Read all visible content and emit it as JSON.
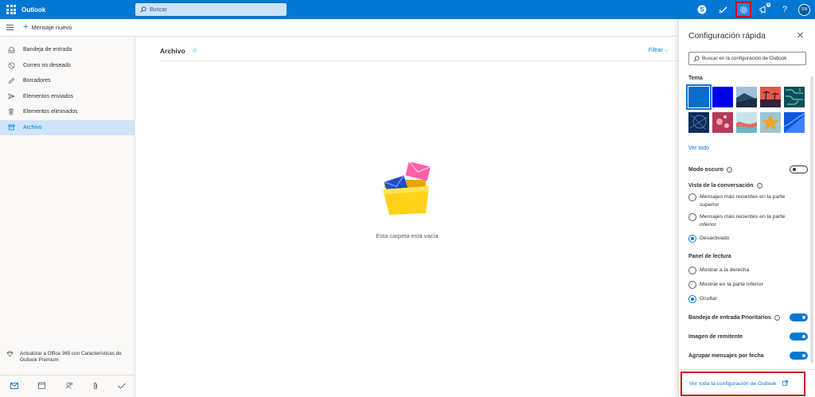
{
  "topbar": {
    "brand": "Outlook",
    "search_placeholder": "Buscar",
    "notification_count": "5",
    "avatar_initials": "SN",
    "help_glyph": "?",
    "bg_color": "#0078d4"
  },
  "cmdbar": {
    "new_message_label": "Mensaje nuevo"
  },
  "nav": {
    "items": [
      {
        "label": "Bandeja de entrada",
        "icon": "inbox-icon"
      },
      {
        "label": "Correo no deseado",
        "icon": "junk-icon"
      },
      {
        "label": "Borradores",
        "icon": "pencil-icon"
      },
      {
        "label": "Elementos enviados",
        "icon": "send-icon"
      },
      {
        "label": "Elementos eliminados",
        "icon": "trash-icon"
      },
      {
        "label": "Archivo",
        "icon": "archive-icon",
        "active": true
      }
    ],
    "upsell_text": "Actualizar a Office 365 con Características de Outlook Premium"
  },
  "main": {
    "folder_title": "Archivo",
    "filter_label": "Filtrar",
    "empty_text": "Esta carpeta está vacía"
  },
  "settings": {
    "title": "Configuración rápida",
    "search_placeholder": "Buscar en la configuración de Outlook",
    "theme_label": "Tema",
    "see_all": "Ver todo",
    "dark_mode": "Modo oscuro",
    "conversation_label": "Vista de la conversación",
    "conversation_options": [
      {
        "label": "Mensajes más recientes en la parte superior",
        "checked": false
      },
      {
        "label": "Mensajes más recientes en la parte inferior",
        "checked": false
      },
      {
        "label": "Desactivado",
        "checked": true
      }
    ],
    "reading_label": "Panel de lectura",
    "reading_options": [
      {
        "label": "Mostrar a la derecha",
        "checked": false
      },
      {
        "label": "Mostrar en la parte inferior",
        "checked": false
      },
      {
        "label": "Ocultar",
        "checked": true
      }
    ],
    "focused_inbox": "Bandeja de entrada Prioritarios",
    "sender_image": "Imagen de remitente",
    "group_by_date": "Agrupar mensajes por fecha",
    "all_settings": "Ver toda la configuración de Outlook"
  }
}
